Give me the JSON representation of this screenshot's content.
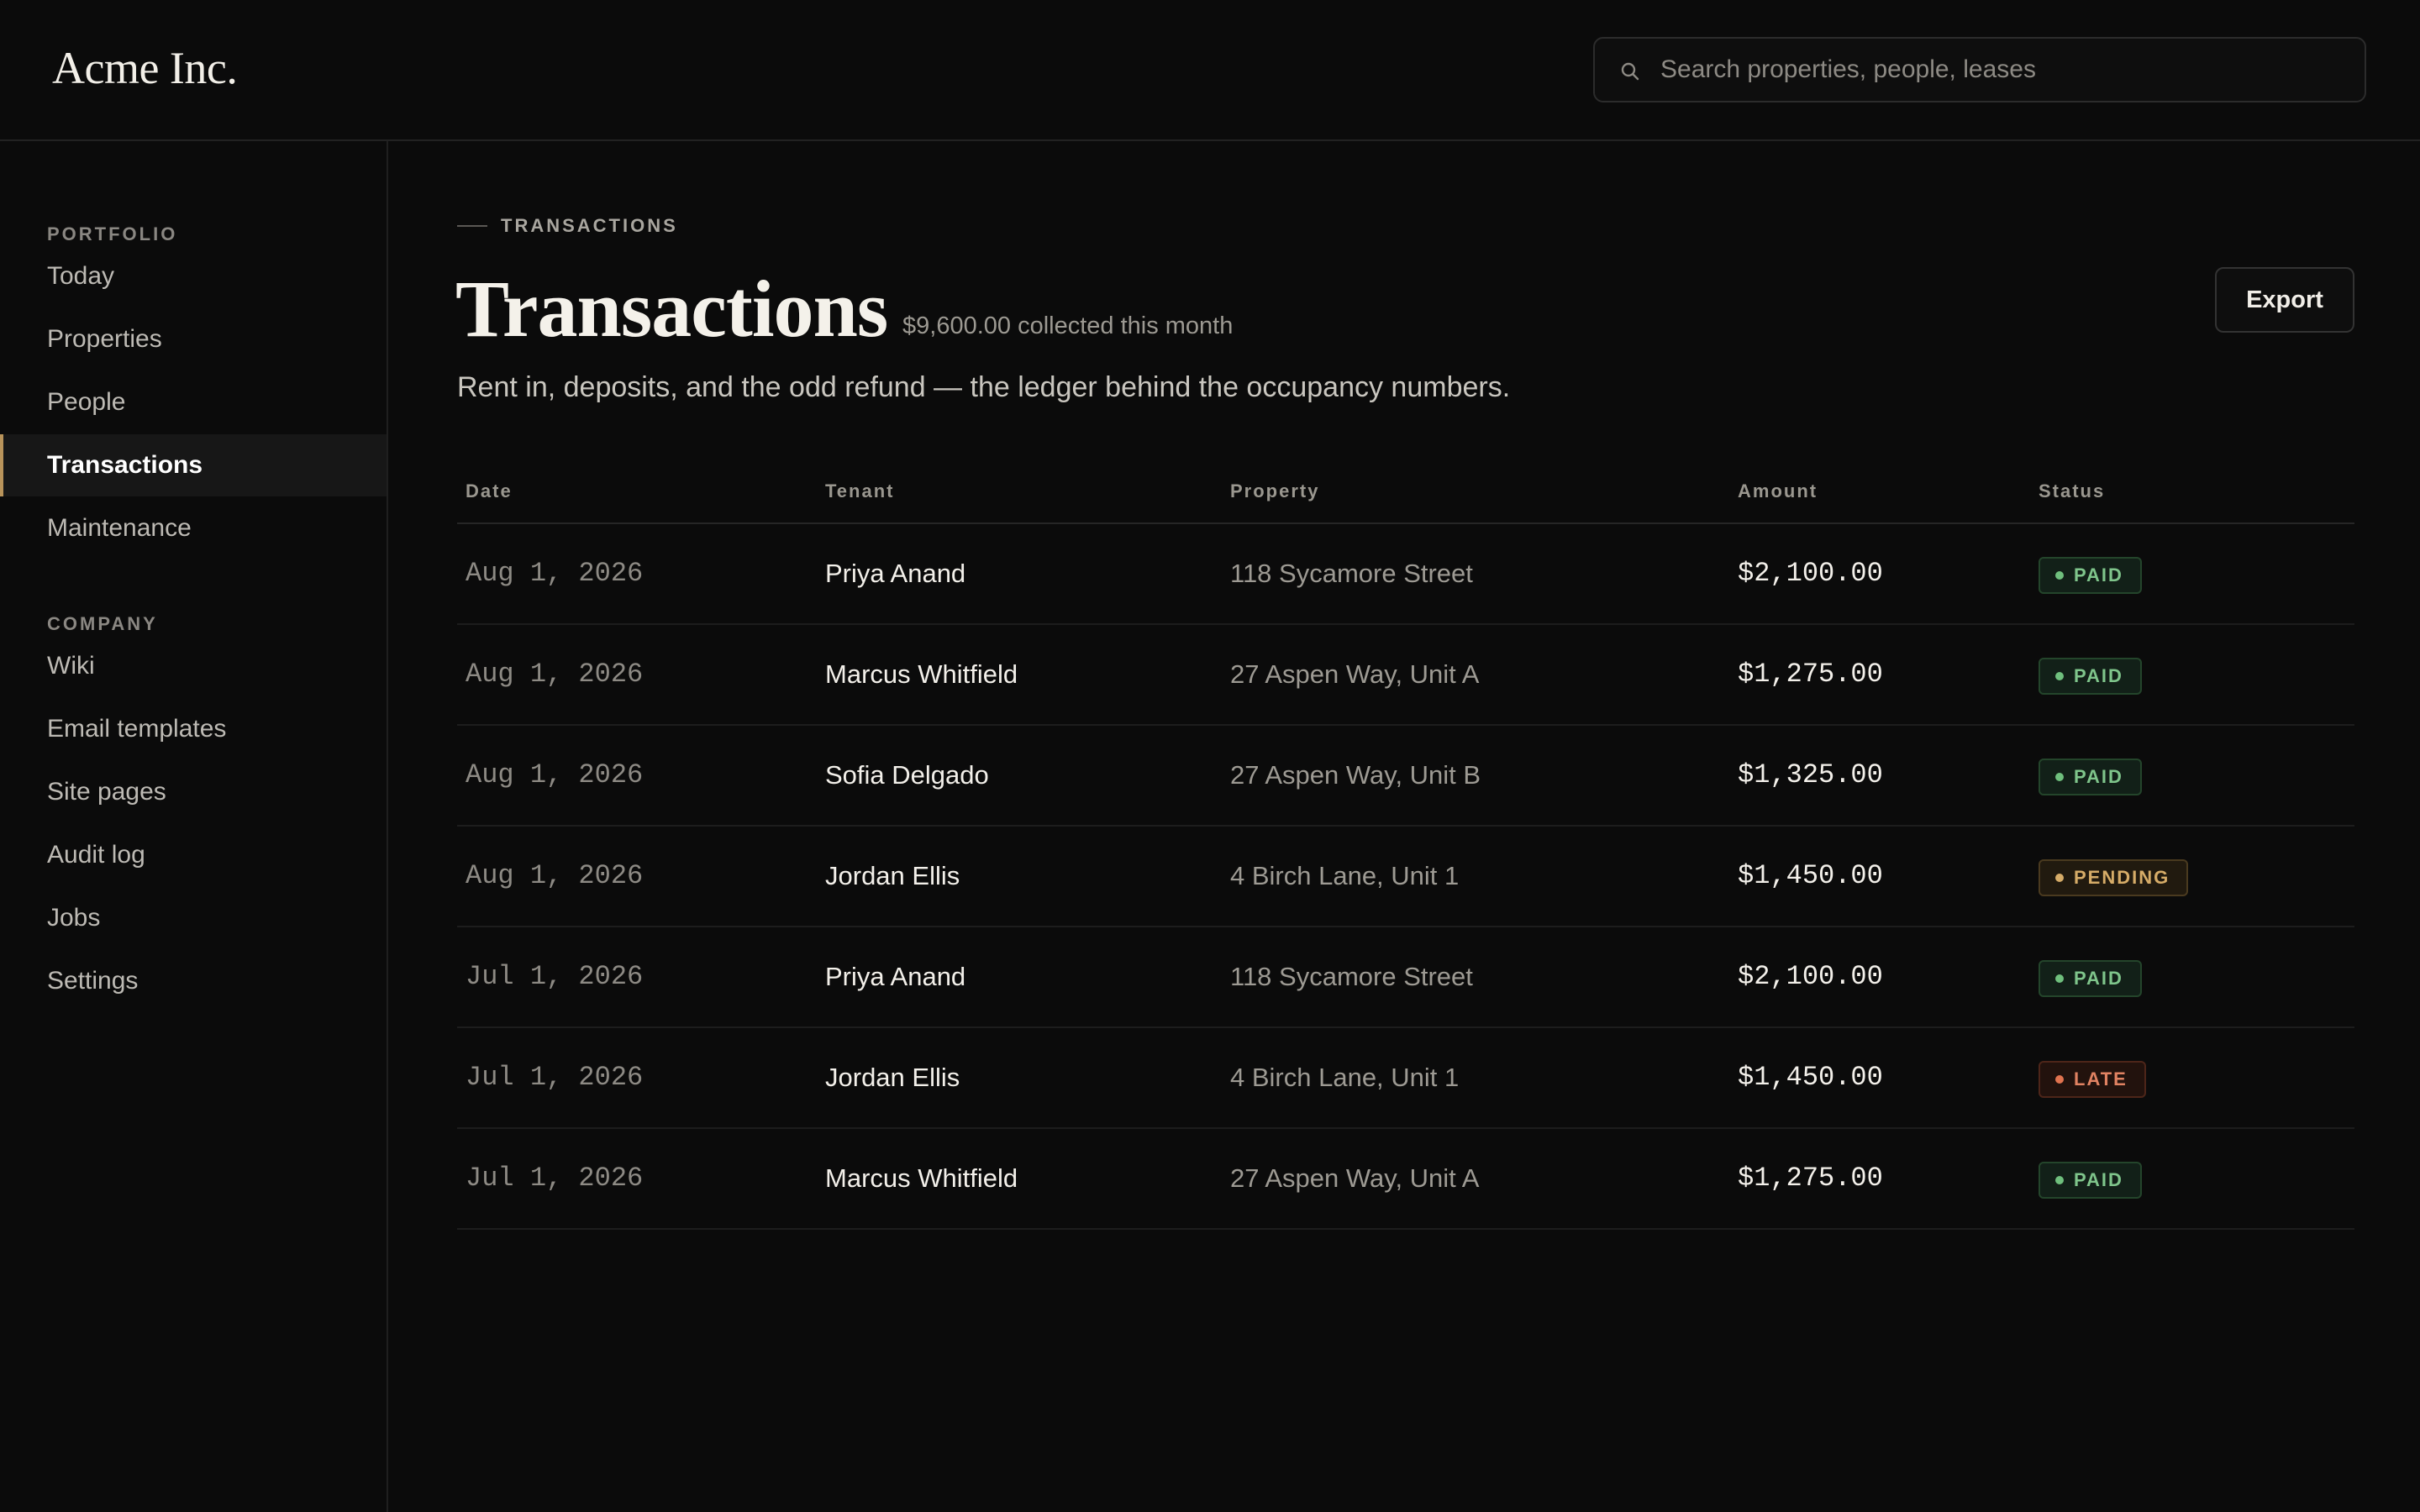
{
  "app": {
    "logo": "Acme Inc."
  },
  "search": {
    "placeholder": "Search properties, people, leases",
    "icon": "search-icon"
  },
  "sidebar": {
    "sections": [
      {
        "label": "PORTFOLIO",
        "items": [
          {
            "label": "Today",
            "active": false
          },
          {
            "label": "Properties",
            "active": false
          },
          {
            "label": "People",
            "active": false
          },
          {
            "label": "Transactions",
            "active": true
          },
          {
            "label": "Maintenance",
            "active": false
          }
        ]
      },
      {
        "label": "COMPANY",
        "items": [
          {
            "label": "Wiki",
            "active": false
          },
          {
            "label": "Email templates",
            "active": false
          },
          {
            "label": "Site pages",
            "active": false
          },
          {
            "label": "Audit log",
            "active": false
          },
          {
            "label": "Jobs",
            "active": false
          },
          {
            "label": "Settings",
            "active": false
          }
        ]
      }
    ],
    "accent_color": "#b8935a"
  },
  "page": {
    "eyebrow": "TRANSACTIONS",
    "title": "Transactions",
    "collected": "$9,600.00 collected this month",
    "subtitle": "Rent in, deposits, and the odd refund — the ledger behind the occupancy numbers.",
    "export_label": "Export"
  },
  "table": {
    "columns": [
      "Date",
      "Tenant",
      "Property",
      "Amount",
      "Status"
    ],
    "rows": [
      {
        "date": "Aug 1, 2026",
        "tenant": "Priya Anand",
        "property": "118 Sycamore Street",
        "amount": "$2,100.00",
        "status": "PAID"
      },
      {
        "date": "Aug 1, 2026",
        "tenant": "Marcus Whitfield",
        "property": "27 Aspen Way, Unit A",
        "amount": "$1,275.00",
        "status": "PAID"
      },
      {
        "date": "Aug 1, 2026",
        "tenant": "Sofia Delgado",
        "property": "27 Aspen Way, Unit B",
        "amount": "$1,325.00",
        "status": "PAID"
      },
      {
        "date": "Aug 1, 2026",
        "tenant": "Jordan Ellis",
        "property": "4 Birch Lane, Unit 1",
        "amount": "$1,450.00",
        "status": "PENDING"
      },
      {
        "date": "Jul 1, 2026",
        "tenant": "Priya Anand",
        "property": "118 Sycamore Street",
        "amount": "$2,100.00",
        "status": "PAID"
      },
      {
        "date": "Jul 1, 2026",
        "tenant": "Jordan Ellis",
        "property": "4 Birch Lane, Unit 1",
        "amount": "$1,450.00",
        "status": "LATE"
      },
      {
        "date": "Jul 1, 2026",
        "tenant": "Marcus Whitfield",
        "property": "27 Aspen Way, Unit A",
        "amount": "$1,275.00",
        "status": "PAID"
      }
    ],
    "status_colors": {
      "PAID": "#7fc58b",
      "PENDING": "#d6ac68",
      "LATE": "#e08262"
    }
  }
}
